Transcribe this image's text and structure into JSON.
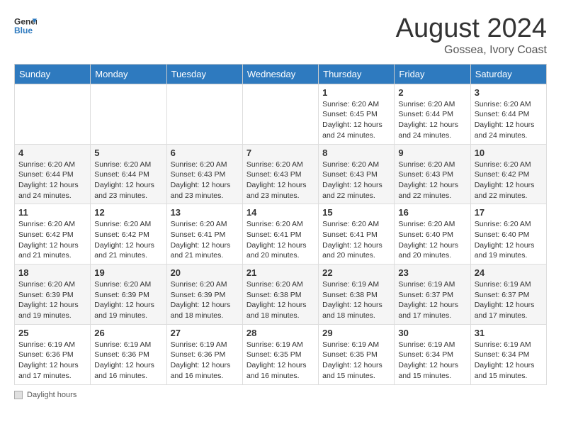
{
  "header": {
    "logo_general": "General",
    "logo_blue": "Blue",
    "month_title": "August 2024",
    "location": "Gossea, Ivory Coast"
  },
  "calendar": {
    "days_of_week": [
      "Sunday",
      "Monday",
      "Tuesday",
      "Wednesday",
      "Thursday",
      "Friday",
      "Saturday"
    ],
    "weeks": [
      [
        {
          "day": "",
          "info": ""
        },
        {
          "day": "",
          "info": ""
        },
        {
          "day": "",
          "info": ""
        },
        {
          "day": "",
          "info": ""
        },
        {
          "day": "1",
          "info": "Sunrise: 6:20 AM\nSunset: 6:45 PM\nDaylight: 12 hours\nand 24 minutes."
        },
        {
          "day": "2",
          "info": "Sunrise: 6:20 AM\nSunset: 6:44 PM\nDaylight: 12 hours\nand 24 minutes."
        },
        {
          "day": "3",
          "info": "Sunrise: 6:20 AM\nSunset: 6:44 PM\nDaylight: 12 hours\nand 24 minutes."
        }
      ],
      [
        {
          "day": "4",
          "info": "Sunrise: 6:20 AM\nSunset: 6:44 PM\nDaylight: 12 hours\nand 24 minutes."
        },
        {
          "day": "5",
          "info": "Sunrise: 6:20 AM\nSunset: 6:44 PM\nDaylight: 12 hours\nand 23 minutes."
        },
        {
          "day": "6",
          "info": "Sunrise: 6:20 AM\nSunset: 6:43 PM\nDaylight: 12 hours\nand 23 minutes."
        },
        {
          "day": "7",
          "info": "Sunrise: 6:20 AM\nSunset: 6:43 PM\nDaylight: 12 hours\nand 23 minutes."
        },
        {
          "day": "8",
          "info": "Sunrise: 6:20 AM\nSunset: 6:43 PM\nDaylight: 12 hours\nand 22 minutes."
        },
        {
          "day": "9",
          "info": "Sunrise: 6:20 AM\nSunset: 6:43 PM\nDaylight: 12 hours\nand 22 minutes."
        },
        {
          "day": "10",
          "info": "Sunrise: 6:20 AM\nSunset: 6:42 PM\nDaylight: 12 hours\nand 22 minutes."
        }
      ],
      [
        {
          "day": "11",
          "info": "Sunrise: 6:20 AM\nSunset: 6:42 PM\nDaylight: 12 hours\nand 21 minutes."
        },
        {
          "day": "12",
          "info": "Sunrise: 6:20 AM\nSunset: 6:42 PM\nDaylight: 12 hours\nand 21 minutes."
        },
        {
          "day": "13",
          "info": "Sunrise: 6:20 AM\nSunset: 6:41 PM\nDaylight: 12 hours\nand 21 minutes."
        },
        {
          "day": "14",
          "info": "Sunrise: 6:20 AM\nSunset: 6:41 PM\nDaylight: 12 hours\nand 20 minutes."
        },
        {
          "day": "15",
          "info": "Sunrise: 6:20 AM\nSunset: 6:41 PM\nDaylight: 12 hours\nand 20 minutes."
        },
        {
          "day": "16",
          "info": "Sunrise: 6:20 AM\nSunset: 6:40 PM\nDaylight: 12 hours\nand 20 minutes."
        },
        {
          "day": "17",
          "info": "Sunrise: 6:20 AM\nSunset: 6:40 PM\nDaylight: 12 hours\nand 19 minutes."
        }
      ],
      [
        {
          "day": "18",
          "info": "Sunrise: 6:20 AM\nSunset: 6:39 PM\nDaylight: 12 hours\nand 19 minutes."
        },
        {
          "day": "19",
          "info": "Sunrise: 6:20 AM\nSunset: 6:39 PM\nDaylight: 12 hours\nand 19 minutes."
        },
        {
          "day": "20",
          "info": "Sunrise: 6:20 AM\nSunset: 6:39 PM\nDaylight: 12 hours\nand 18 minutes."
        },
        {
          "day": "21",
          "info": "Sunrise: 6:20 AM\nSunset: 6:38 PM\nDaylight: 12 hours\nand 18 minutes."
        },
        {
          "day": "22",
          "info": "Sunrise: 6:19 AM\nSunset: 6:38 PM\nDaylight: 12 hours\nand 18 minutes."
        },
        {
          "day": "23",
          "info": "Sunrise: 6:19 AM\nSunset: 6:37 PM\nDaylight: 12 hours\nand 17 minutes."
        },
        {
          "day": "24",
          "info": "Sunrise: 6:19 AM\nSunset: 6:37 PM\nDaylight: 12 hours\nand 17 minutes."
        }
      ],
      [
        {
          "day": "25",
          "info": "Sunrise: 6:19 AM\nSunset: 6:36 PM\nDaylight: 12 hours\nand 17 minutes."
        },
        {
          "day": "26",
          "info": "Sunrise: 6:19 AM\nSunset: 6:36 PM\nDaylight: 12 hours\nand 16 minutes."
        },
        {
          "day": "27",
          "info": "Sunrise: 6:19 AM\nSunset: 6:36 PM\nDaylight: 12 hours\nand 16 minutes."
        },
        {
          "day": "28",
          "info": "Sunrise: 6:19 AM\nSunset: 6:35 PM\nDaylight: 12 hours\nand 16 minutes."
        },
        {
          "day": "29",
          "info": "Sunrise: 6:19 AM\nSunset: 6:35 PM\nDaylight: 12 hours\nand 15 minutes."
        },
        {
          "day": "30",
          "info": "Sunrise: 6:19 AM\nSunset: 6:34 PM\nDaylight: 12 hours\nand 15 minutes."
        },
        {
          "day": "31",
          "info": "Sunrise: 6:19 AM\nSunset: 6:34 PM\nDaylight: 12 hours\nand 15 minutes."
        }
      ]
    ]
  },
  "footer": {
    "daylight_label": "Daylight hours"
  }
}
